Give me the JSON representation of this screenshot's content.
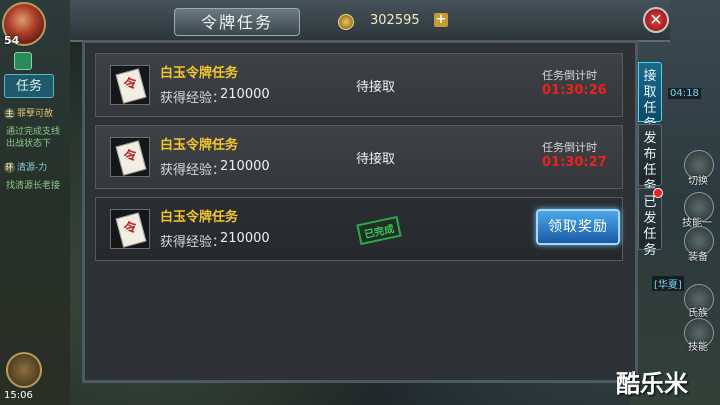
{
  "header": {
    "title": "令牌任务",
    "currency_value": "302595",
    "plus_label": "+",
    "close_label": "✕"
  },
  "hud_left": {
    "level": "54",
    "task_tab_label": "任务",
    "quests": [
      {
        "tag": "主",
        "title": "罪孽可赦",
        "desc": "通过完成支线",
        "desc2": "出战状态下"
      },
      {
        "tag": "环",
        "title": "清源-力",
        "desc": "找清源长老接"
      }
    ],
    "time": "15:06"
  },
  "hud_right": {
    "buttons": [
      {
        "label": "切换"
      },
      {
        "label": "技能一"
      },
      {
        "label": "装备"
      },
      {
        "label": "氏族"
      },
      {
        "label": "技能"
      }
    ],
    "tag_text": "[华夏]",
    "clock": "04:18"
  },
  "quests": [
    {
      "name": "白玉令牌任务",
      "exp_label": "获得经验：",
      "exp_value": "210000",
      "status": "待接取",
      "countdown_label": "任务倒计时",
      "countdown": "01:30:26"
    },
    {
      "name": "白玉令牌任务",
      "exp_label": "获得经验：",
      "exp_value": "210000",
      "status": "待接取",
      "countdown_label": "任务倒计时",
      "countdown": "01:30:27"
    },
    {
      "name": "白玉令牌任务",
      "exp_label": "获得经验：",
      "exp_value": "210000",
      "stamp": "已完成",
      "claim_label": "领取奖励"
    }
  ],
  "token_glyph": "令",
  "side_tabs": [
    {
      "label": "接取任务"
    },
    {
      "label": "发布任务"
    },
    {
      "label": "已发任务"
    }
  ],
  "watermark": "酷乐米"
}
